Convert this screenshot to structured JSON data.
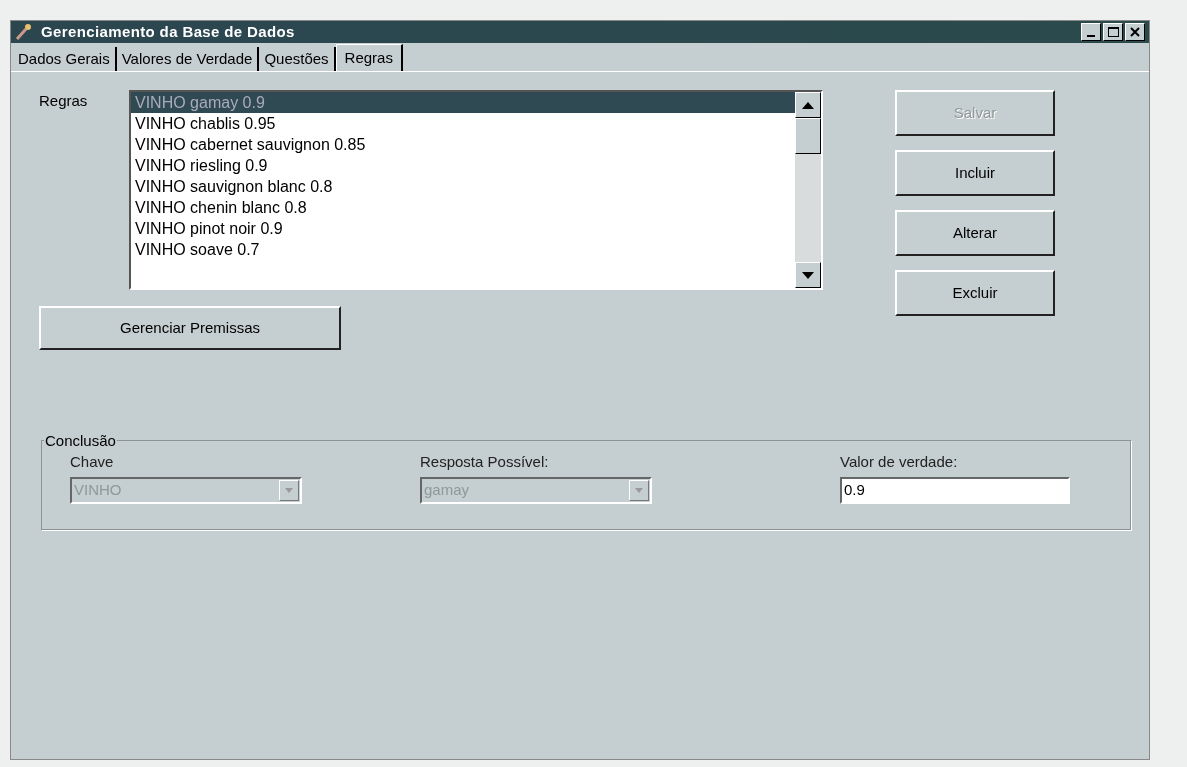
{
  "window": {
    "title": "Gerenciamento da Base de Dados"
  },
  "tabs": [
    {
      "label": "Dados Gerais",
      "selected": false
    },
    {
      "label": "Valores de Verdade",
      "selected": false
    },
    {
      "label": "Questões",
      "selected": false
    },
    {
      "label": "Regras",
      "selected": true
    }
  ],
  "rules": {
    "label": "Regras",
    "items": [
      {
        "text": "VINHO gamay 0.9",
        "selected": true
      },
      {
        "text": "VINHO chablis 0.95",
        "selected": false
      },
      {
        "text": "VINHO cabernet sauvignon 0.85",
        "selected": false
      },
      {
        "text": "VINHO riesling 0.9",
        "selected": false
      },
      {
        "text": "VINHO sauvignon blanc 0.8",
        "selected": false
      },
      {
        "text": "VINHO chenin blanc 0.8",
        "selected": false
      },
      {
        "text": "VINHO pinot noir 0.9",
        "selected": false
      },
      {
        "text": "VINHO soave 0.7",
        "selected": false
      }
    ]
  },
  "buttons": [
    {
      "label": "Salvar",
      "disabled": true
    },
    {
      "label": "Incluir",
      "disabled": false
    },
    {
      "label": "Alterar",
      "disabled": false
    },
    {
      "label": "Excluir",
      "disabled": false
    }
  ],
  "manage_button": {
    "label": "Gerenciar Premissas"
  },
  "conclusion": {
    "title": "Conclusão",
    "fields": [
      {
        "kind": "combo",
        "label": "Chave",
        "value": "VINHO",
        "disabled": true
      },
      {
        "kind": "combo",
        "label": "Resposta Possível:",
        "value": "gamay",
        "disabled": true
      },
      {
        "kind": "text",
        "label": "Valor de verdade:",
        "value": "0.9",
        "disabled": false
      }
    ]
  }
}
